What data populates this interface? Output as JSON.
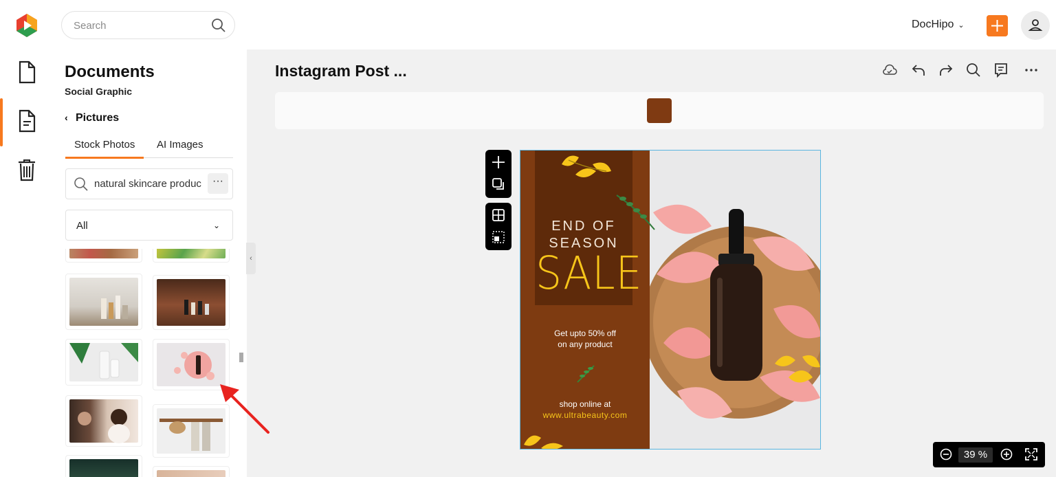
{
  "header": {
    "search_placeholder": "Search",
    "account_name": "DocHipo",
    "new_button": "+",
    "accent": "#f7791f"
  },
  "rail": {
    "items": [
      "document-icon",
      "template-document-icon",
      "trash-icon"
    ]
  },
  "panel": {
    "title": "Documents",
    "subtitle": "Social Graphic",
    "back_label": "Pictures",
    "tabs": [
      "Stock Photos",
      "AI Images"
    ],
    "search_value": "natural skincare produc",
    "more_label": "···",
    "filter_value": "All"
  },
  "thumbnails": [
    {
      "name": "cosmetics-strip"
    },
    {
      "name": "green-leaf-strip"
    },
    {
      "name": "skincare-bottles-on-shelf"
    },
    {
      "name": "skincare-bottles-on-wood"
    },
    {
      "name": "monstera-leaves-products"
    },
    {
      "name": "dropper-bottle-petals"
    },
    {
      "name": "woman-mirror-makeup"
    },
    {
      "name": "hanging-hats-towels"
    },
    {
      "name": "dark-flowers"
    },
    {
      "name": "beige-texture"
    }
  ],
  "document": {
    "title": "Instagram Post ...",
    "swatch_color": "#7f3a12"
  },
  "design": {
    "line1": "END OF",
    "line2": "SEASON",
    "headline": "SALE",
    "offer_line1": "Get upto 50% off",
    "offer_line2": "on any product",
    "shop_line": "shop online at",
    "url": "www.ultrabeauty.com"
  },
  "zoom": {
    "value": "39 %"
  }
}
